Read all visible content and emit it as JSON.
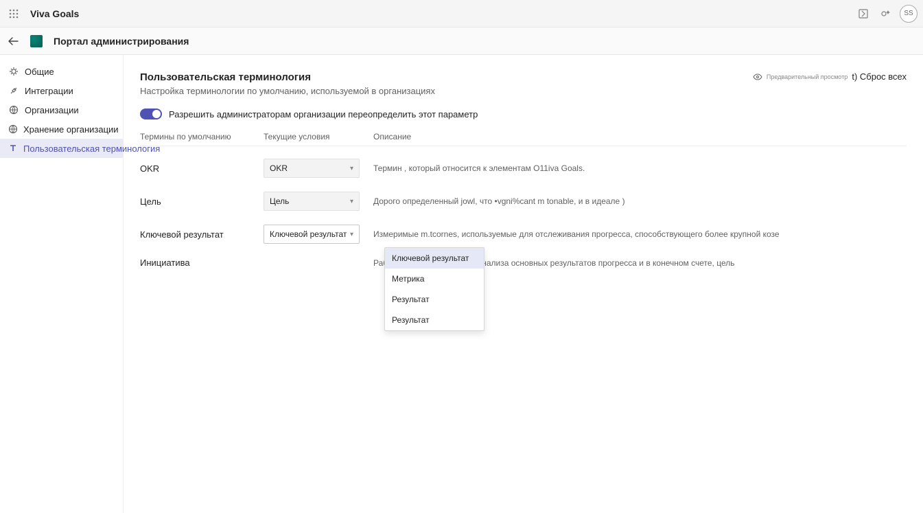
{
  "topbar": {
    "app_title": "Viva Goals",
    "avatar": "SS"
  },
  "subbar": {
    "portal_title": "Портал администрирования"
  },
  "sidebar": {
    "items": [
      {
        "label": "Общие"
      },
      {
        "label": "Интеграции"
      },
      {
        "label": "Организации"
      },
      {
        "label": "Хранение организации"
      },
      {
        "label": "Пользовательская терминология"
      }
    ]
  },
  "page": {
    "title": "Пользовательская терминология",
    "subtitle": "Настройка терминологии по умолчанию, используемой в организациях",
    "preview_tiny": "Предварительный просмотр",
    "reset_all": "t) Сброс всех"
  },
  "toggle": {
    "label": "Разрешить администраторам организации переопределить этот параметр"
  },
  "table": {
    "headers": {
      "default": "Термины по умолчанию",
      "current": "Текущие условия",
      "desc": "Описание"
    },
    "rows": [
      {
        "default": "OKR",
        "current": "OKR",
        "desc": "Термин , который относится к элементам O11iva Goals."
      },
      {
        "default": "Цель",
        "current": "Цель",
        "desc": "Дорого определенный jowl, что •vgni%cant m tonable, и в идеале )"
      },
      {
        "default": "Ключевой результат",
        "current": "Ключевой результат",
        "desc": "Измеримые m.tcornes, используемые для отслеживания прогресса, способствующего более крупной козе"
      },
      {
        "default": "Инициатива",
        "current": "",
        "desc": "Работа, предпринятая для анализа основных результатов прогресса и в конечном счете, цель"
      }
    ]
  },
  "dropdown": {
    "items": [
      "Ключевой результат",
      "Метрика",
      "Результат",
      "Результат"
    ]
  }
}
